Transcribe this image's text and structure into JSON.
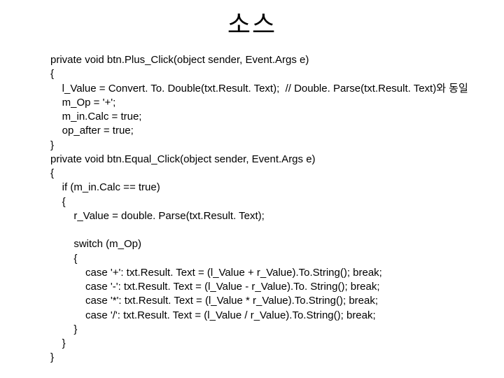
{
  "title": "소스",
  "code_lines": [
    "private void btn.Plus_Click(object sender, Event.Args e)",
    "{",
    "    l_Value = Convert. To. Double(txt.Result. Text);  // Double. Parse(txt.Result. Text)와 동일",
    "    m_Op = '+';",
    "    m_in.Calc = true;",
    "    op_after = true;",
    "}",
    "private void btn.Equal_Click(object sender, Event.Args e)",
    "{",
    "    if (m_in.Calc == true)",
    "    {",
    "        r_Value = double. Parse(txt.Result. Text);",
    "",
    "        switch (m_Op)",
    "        {",
    "            case '+': txt.Result. Text = (l_Value + r_Value).To.String(); break;",
    "            case '-': txt.Result. Text = (l_Value - r_Value).To. String(); break;",
    "            case '*': txt.Result. Text = (l_Value * r_Value).To.String(); break;",
    "            case '/': txt.Result. Text = (l_Value / r_Value).To.String(); break;",
    "        }",
    "    }",
    "}"
  ]
}
